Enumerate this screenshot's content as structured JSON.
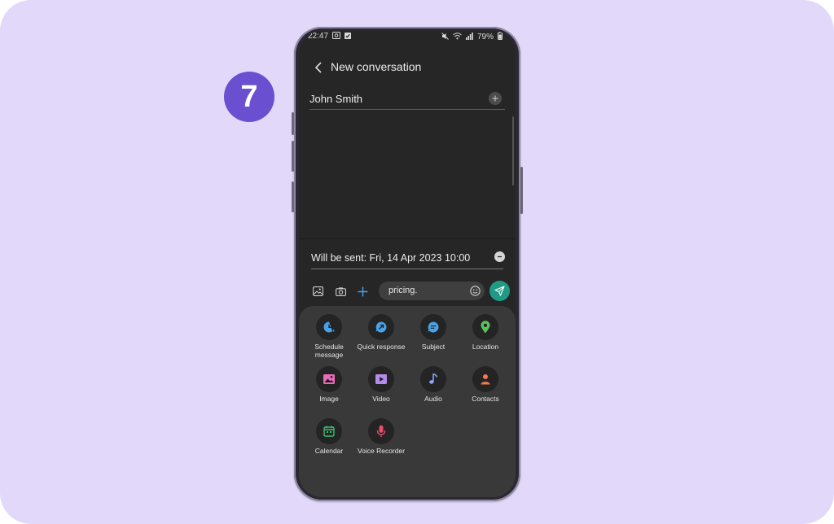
{
  "tutorial": {
    "step_number": "7"
  },
  "status_bar": {
    "time": "22:47",
    "battery": "79%"
  },
  "header": {
    "title": "New conversation"
  },
  "recipient": {
    "name": "John Smith"
  },
  "schedule": {
    "text": "Will be sent: Fri, 14 Apr 2023 10:00"
  },
  "compose": {
    "message_text": "pricing."
  },
  "attachments": [
    {
      "label": "Schedule message",
      "icon": "clock-icon",
      "color": "#4aa3e8"
    },
    {
      "label": "Quick response",
      "icon": "quick-response-icon",
      "color": "#4aa3e8"
    },
    {
      "label": "Subject",
      "icon": "subject-icon",
      "color": "#4aa3e8"
    },
    {
      "label": "Location",
      "icon": "location-pin-icon",
      "color": "#5cc05c"
    },
    {
      "label": "Image",
      "icon": "image-icon",
      "color": "#e86ab8"
    },
    {
      "label": "Video",
      "icon": "video-icon",
      "color": "#b48be8"
    },
    {
      "label": "Audio",
      "icon": "music-note-icon",
      "color": "#8aa8ff"
    },
    {
      "label": "Contacts",
      "icon": "contact-icon",
      "color": "#f07a4a"
    },
    {
      "label": "Calendar",
      "icon": "calendar-icon",
      "color": "#3bbf6e"
    },
    {
      "label": "Voice Recorder",
      "icon": "microphone-icon",
      "color": "#e8506a"
    }
  ],
  "colors": {
    "background": "#e2d9fa",
    "badge": "#6a4fd0",
    "screen": "#262626",
    "send_button": "#1f9a84",
    "accent_plus": "#4aa3e8"
  }
}
